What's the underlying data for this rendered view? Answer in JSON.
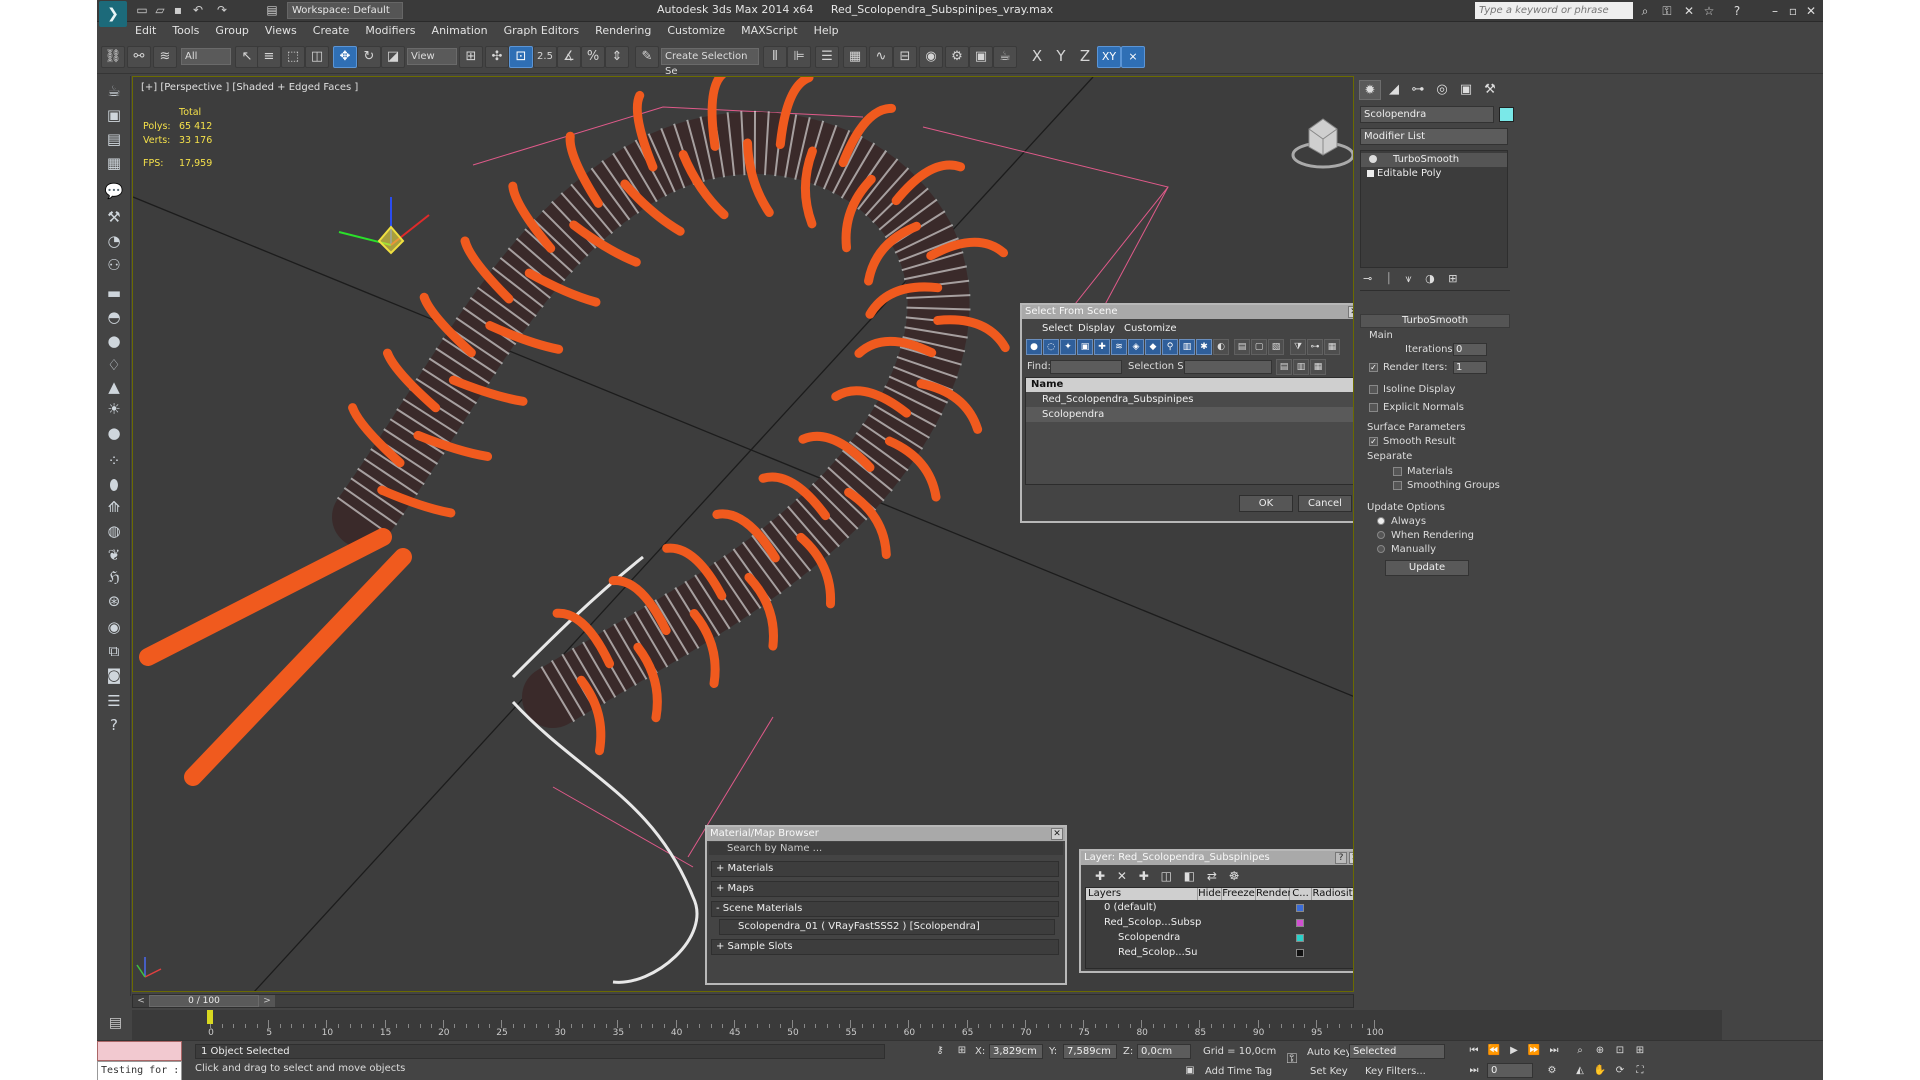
{
  "titlebar": {
    "workspace": "Workspace: Default",
    "app_name": "Autodesk 3ds Max  2014 x64",
    "file_name": "Red_Scolopendra_Subspinipes_vray.max",
    "search_placeholder": "Type a keyword or phrase"
  },
  "menu": [
    "Edit",
    "Tools",
    "Group",
    "Views",
    "Create",
    "Modifiers",
    "Animation",
    "Graph Editors",
    "Rendering",
    "Customize",
    "MAXScript",
    "Help"
  ],
  "toolbar": {
    "filter": "All",
    "ref_coord": "View",
    "snap_label": "2.5",
    "named_selection": "Create Selection Se",
    "axis_x": "X",
    "axis_y": "Y",
    "axis_z": "Z",
    "axis_xy": "XY"
  },
  "viewport": {
    "label": "[+] [Perspective ] [Shaded + Edged Faces ]",
    "stats": {
      "total_label": "Total",
      "polys_label": "Polys:",
      "polys_value": "65 412",
      "verts_label": "Verts:",
      "verts_value": "33 176",
      "fps_label": "FPS:",
      "fps_value": "17,959"
    },
    "colors": {
      "legs": "#f05a1e",
      "body": "#3a2a2a",
      "wire": "#ffffff",
      "grid": "#e05a8a"
    }
  },
  "command_panel": {
    "object_name": "Scolopendra",
    "object_color": "#7ae8e8",
    "modifier_list": "Modifier List",
    "stack": [
      "TurboSmooth",
      "Editable Poly"
    ],
    "turbosmooth": {
      "title": "TurboSmooth",
      "main": "Main",
      "iterations_label": "Iterations:",
      "iterations": "0",
      "render_iters_label": "Render Iters:",
      "render_iters": "1",
      "isoline": "Isoline Display",
      "explicit_normals": "Explicit Normals",
      "surface_params": "Surface Parameters",
      "smooth_result": "Smooth Result",
      "separate": "Separate",
      "materials": "Materials",
      "smoothing_groups": "Smoothing Groups",
      "update_options": "Update Options",
      "always": "Always",
      "when_rendering": "When Rendering",
      "manually": "Manually",
      "update": "Update"
    }
  },
  "select_from_scene": {
    "title": "Select From Scene",
    "menu": [
      "Select",
      "Display",
      "Customize"
    ],
    "find_label": "Find:",
    "selection_set_label": "Selection Set:",
    "column_name": "Name",
    "rows": [
      "Red_Scolopendra_Subspinipes",
      "Scolopendra"
    ],
    "ok": "OK",
    "cancel": "Cancel"
  },
  "material_browser": {
    "title": "Material/Map Browser",
    "search_placeholder": "Search by Name ...",
    "sections": [
      "+ Materials",
      "+ Maps",
      "- Scene Materials"
    ],
    "scene_material": "Scolopendra_01  ( VRayFastSSS2 ) [Scolopendra]",
    "sample_slots": "+ Sample Slots"
  },
  "layer_dialog": {
    "title": "Layer: Red_Scolopendra_Subspinipes",
    "columns": [
      "Layers",
      "Hide",
      "Freeze",
      "Render",
      "C...",
      "Radiosity"
    ],
    "rows": [
      "0 (default)",
      "Red_Scolop...Subsp",
      "Scolopendra",
      "Red_Scolop...Su"
    ],
    "swatches": [
      "#3a6cd8",
      "#d050d0",
      "#2ad0c8",
      "#111111"
    ]
  },
  "timeline": {
    "frame": "0 / 100",
    "ticks": [
      "0",
      "5",
      "10",
      "15",
      "20",
      "25",
      "30",
      "35",
      "40",
      "45",
      "50",
      "55",
      "60",
      "65",
      "70",
      "75",
      "80",
      "85",
      "90",
      "95",
      "100"
    ]
  },
  "status": {
    "maxscript_text": "Testing for :",
    "selected": "1 Object Selected",
    "prompt": "Click and drag to select and move objects",
    "x_label": "X:",
    "x_value": "3,829cm",
    "y_label": "Y:",
    "y_value": "7,589cm",
    "z_label": "Z:",
    "z_value": "0,0cm",
    "grid": "Grid = 10,0cm",
    "add_time_tag": "Add Time Tag",
    "auto_key": "Auto Key",
    "selected_dropdown": "Selected",
    "set_key": "Set Key",
    "key_filters": "Key Filters...",
    "frame_value": "0"
  }
}
